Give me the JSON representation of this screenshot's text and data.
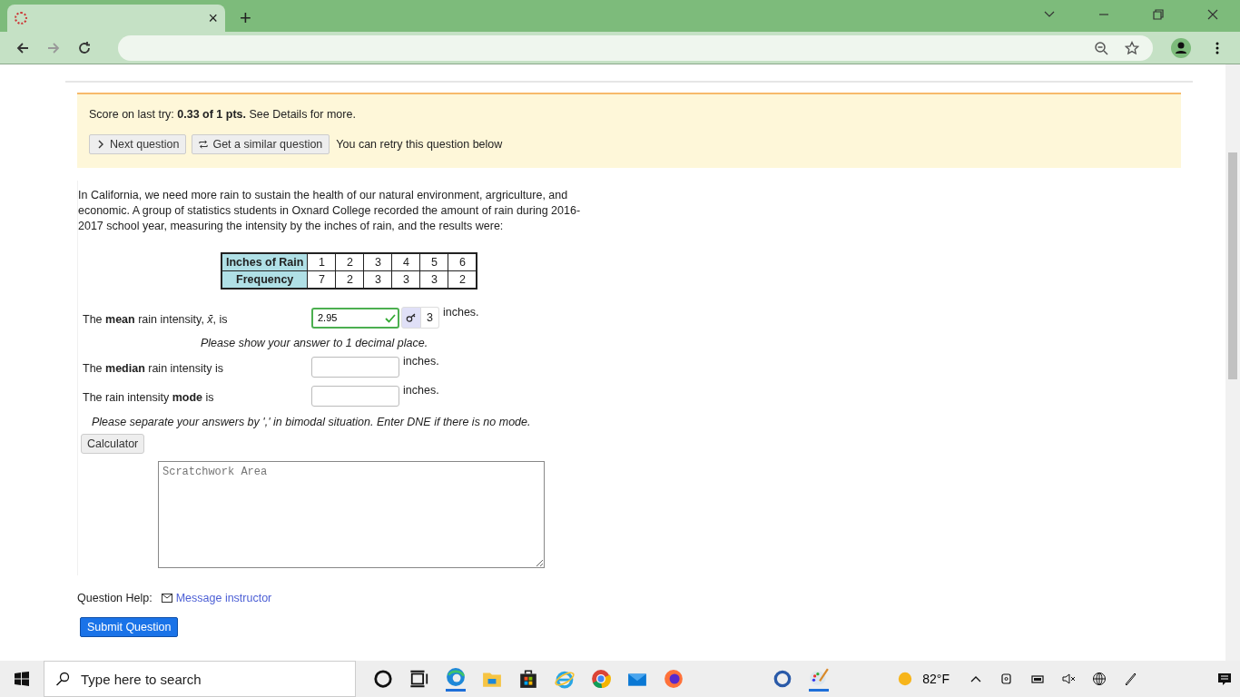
{
  "browser": {
    "tab_close": "×",
    "new_tab": "+"
  },
  "banner": {
    "score": "Score on last try: **0.33 of 1 pts.** See Details for more.",
    "buttons": [
      {
        "kind": "next",
        "label": "Next question"
      },
      {
        "kind": "similar",
        "label": "Get a similar question"
      }
    ],
    "note": "You can retry this question below"
  },
  "question": {
    "intro": "In California, we need more rain to sustain the health of our natural environment, argriculture, and economic. A group of statistics students in Oxnard College recorded the amount of rain during 2016-2017 school year, measuring the intensity by the inches of rain, and the results were:",
    "table": [
      {
        "header": "Inches of Rain",
        "cells": [
          "1",
          "2",
          "3",
          "4",
          "5",
          "6"
        ]
      },
      {
        "header": "Frequency",
        "cells": [
          "7",
          "2",
          "3",
          "3",
          "3",
          "2"
        ]
      }
    ],
    "answers": [
      {
        "label": "The **mean** rain intensity, *x̄*, is",
        "value": "2.95",
        "correct": true,
        "key": "3",
        "unit": "inches.",
        "hint": "Please show your answer to 1 decimal place."
      },
      {
        "label": "The **median** rain intensity is",
        "unit": "inches."
      },
      {
        "label": "The rain intensity **mode** is",
        "unit": "inches."
      }
    ],
    "note": "Please separate your answers by ',' in bimodal situation. Enter DNE if there is no mode.",
    "calculator": "Calculator",
    "scratch_placeholder": "Scratchwork Area"
  },
  "help": {
    "label": "Question Help:",
    "link": "Message instructor"
  },
  "submit": "Submit Question",
  "taskbar": {
    "search_placeholder": "Type here to search",
    "weather": "82°F"
  }
}
